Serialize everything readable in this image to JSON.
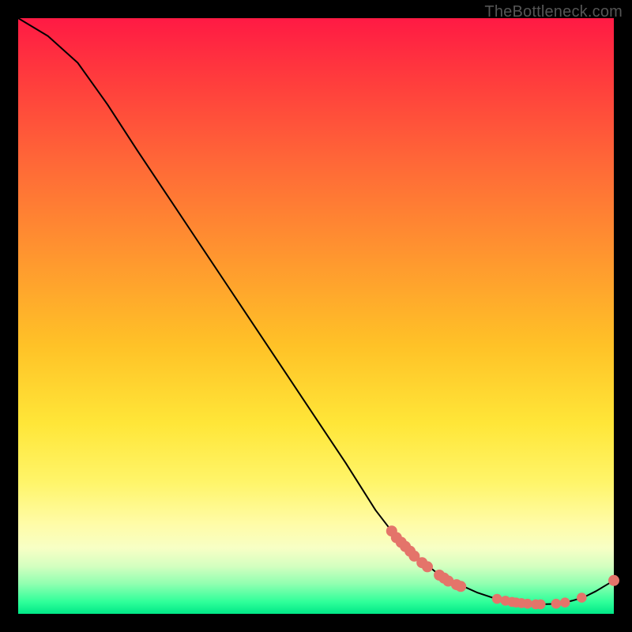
{
  "attribution": "TheBottleneck.com",
  "colors": {
    "marker": "#e4746a",
    "curve": "#000000",
    "background": "#000000"
  },
  "chart_data": {
    "type": "line",
    "title": "",
    "xlabel": "",
    "ylabel": "",
    "xlim": [
      0,
      100
    ],
    "ylim": [
      0,
      100
    ],
    "grid": false,
    "legend": false,
    "note": "Axes are unlabeled in the source image; values are pixel-fraction estimates (0–100 of plot area). Vertical axis is inverted vs screen y (0 = bottom).",
    "series": [
      {
        "name": "bottleneck-curve",
        "x": [
          0.0,
          5.0,
          10.0,
          15.0,
          20.0,
          25.0,
          30.0,
          35.0,
          40.0,
          45.0,
          50.0,
          55.0,
          60.0,
          63.0,
          67.0,
          70.0,
          73.0,
          77.0,
          80.0,
          83.0,
          85.0,
          88.0,
          91.0,
          93.0,
          95.0,
          97.0,
          100.0
        ],
        "y": [
          100.0,
          97.0,
          92.5,
          85.5,
          77.8,
          70.3,
          62.8,
          55.3,
          47.8,
          40.3,
          32.8,
          25.3,
          17.4,
          13.5,
          9.6,
          7.1,
          5.4,
          3.6,
          2.6,
          2.0,
          1.7,
          1.6,
          1.7,
          2.2,
          2.8,
          3.8,
          5.6
        ]
      }
    ],
    "markers": [
      {
        "x": 62.7,
        "y": 13.9,
        "r": 1.0
      },
      {
        "x": 63.5,
        "y": 12.8,
        "r": 1.0
      },
      {
        "x": 64.3,
        "y": 12.0,
        "r": 1.0
      },
      {
        "x": 65.0,
        "y": 11.3,
        "r": 1.0
      },
      {
        "x": 65.8,
        "y": 10.5,
        "r": 1.0
      },
      {
        "x": 66.5,
        "y": 9.7,
        "r": 1.0
      },
      {
        "x": 67.8,
        "y": 8.6,
        "r": 1.0
      },
      {
        "x": 68.7,
        "y": 7.9,
        "r": 1.0
      },
      {
        "x": 70.7,
        "y": 6.5,
        "r": 1.0
      },
      {
        "x": 71.5,
        "y": 6.0,
        "r": 1.0
      },
      {
        "x": 72.2,
        "y": 5.5,
        "r": 1.0
      },
      {
        "x": 73.6,
        "y": 4.9,
        "r": 1.0
      },
      {
        "x": 74.3,
        "y": 4.6,
        "r": 1.0
      },
      {
        "x": 80.4,
        "y": 2.5,
        "r": 0.9
      },
      {
        "x": 81.8,
        "y": 2.2,
        "r": 0.9
      },
      {
        "x": 82.9,
        "y": 2.0,
        "r": 0.9
      },
      {
        "x": 83.6,
        "y": 1.9,
        "r": 0.9
      },
      {
        "x": 84.5,
        "y": 1.8,
        "r": 0.9
      },
      {
        "x": 85.5,
        "y": 1.7,
        "r": 0.9
      },
      {
        "x": 86.9,
        "y": 1.6,
        "r": 0.9
      },
      {
        "x": 87.7,
        "y": 1.6,
        "r": 0.9
      },
      {
        "x": 90.3,
        "y": 1.7,
        "r": 0.9
      },
      {
        "x": 91.8,
        "y": 1.9,
        "r": 0.9
      },
      {
        "x": 94.6,
        "y": 2.7,
        "r": 0.9
      },
      {
        "x": 100.0,
        "y": 5.6,
        "r": 1.0
      }
    ]
  }
}
